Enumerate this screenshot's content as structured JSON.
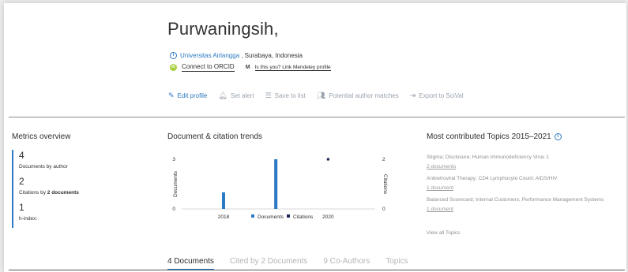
{
  "author": {
    "name": "Purwaningsih,",
    "institution": "Universitas Airlangga",
    "location": ", Surabaya, Indonesia",
    "orcid_label": "Connect to ORCID",
    "mendeley_icon": "M",
    "mendeley_label": "Is this you? Link Mendeley profile"
  },
  "actions": [
    {
      "icon": "pencil-icon",
      "label": "Edit profile"
    },
    {
      "icon": "bell-icon",
      "label": "Set alert"
    },
    {
      "icon": "list-icon",
      "label": "Save to list"
    },
    {
      "icon": "people-icon",
      "label": "Potential author matches"
    },
    {
      "icon": "export-icon",
      "label": "Export to SciVal"
    }
  ],
  "metrics": {
    "title": "Metrics overview",
    "documents": {
      "value": "4",
      "label": "Documents by author"
    },
    "citations": {
      "value": "2",
      "label_prefix": "Citations by ",
      "label_bold": "2 documents"
    },
    "hindex": {
      "value": "1",
      "label": "h-index:"
    }
  },
  "chart_title": "Document & citation trends",
  "chart_data": {
    "type": "bar",
    "title": "Document & citation trends",
    "x_ticks": [
      "2018",
      "2020"
    ],
    "ylabel_left": "Documents",
    "ylabel_right": "Citations",
    "ylim_left": [
      0,
      3
    ],
    "ylim_right": [
      0,
      2
    ],
    "y_ticks_left": [
      "3",
      "0"
    ],
    "y_ticks_right": [
      "2",
      "0"
    ],
    "series": [
      {
        "name": "Documents",
        "type": "bar",
        "color": "#2b79c2",
        "points": [
          {
            "x": 2018,
            "y": 1
          },
          {
            "x": 2019,
            "y": 3
          }
        ]
      },
      {
        "name": "Citations",
        "type": "scatter",
        "color": "#1e2a5a",
        "points": [
          {
            "x": 2020,
            "y": 2
          }
        ]
      }
    ],
    "legend": [
      "Documents",
      "Citations"
    ]
  },
  "topics": {
    "title": "Most contributed Topics 2015–2021",
    "items": [
      {
        "name": "Stigma; Disclosure; Human Immunodeficiency Virus 1",
        "docs": "2 documents"
      },
      {
        "name": "Antiretroviral Therapy; CD4 Lymphocyte Count; AIDS/HIV",
        "docs": "1 document"
      },
      {
        "name": "Balanced Scorecard; Internal Customers; Performance Management Systems",
        "docs": "1 document"
      }
    ],
    "view_all": "View all Topics"
  },
  "tabs": [
    "4 Documents",
    "Cited by 2 Documents",
    "9 Co-Authors",
    "Topics"
  ],
  "colors": {
    "accent": "#2b79c2",
    "orcid": "#a6ce39",
    "citations": "#1e2a5a"
  }
}
